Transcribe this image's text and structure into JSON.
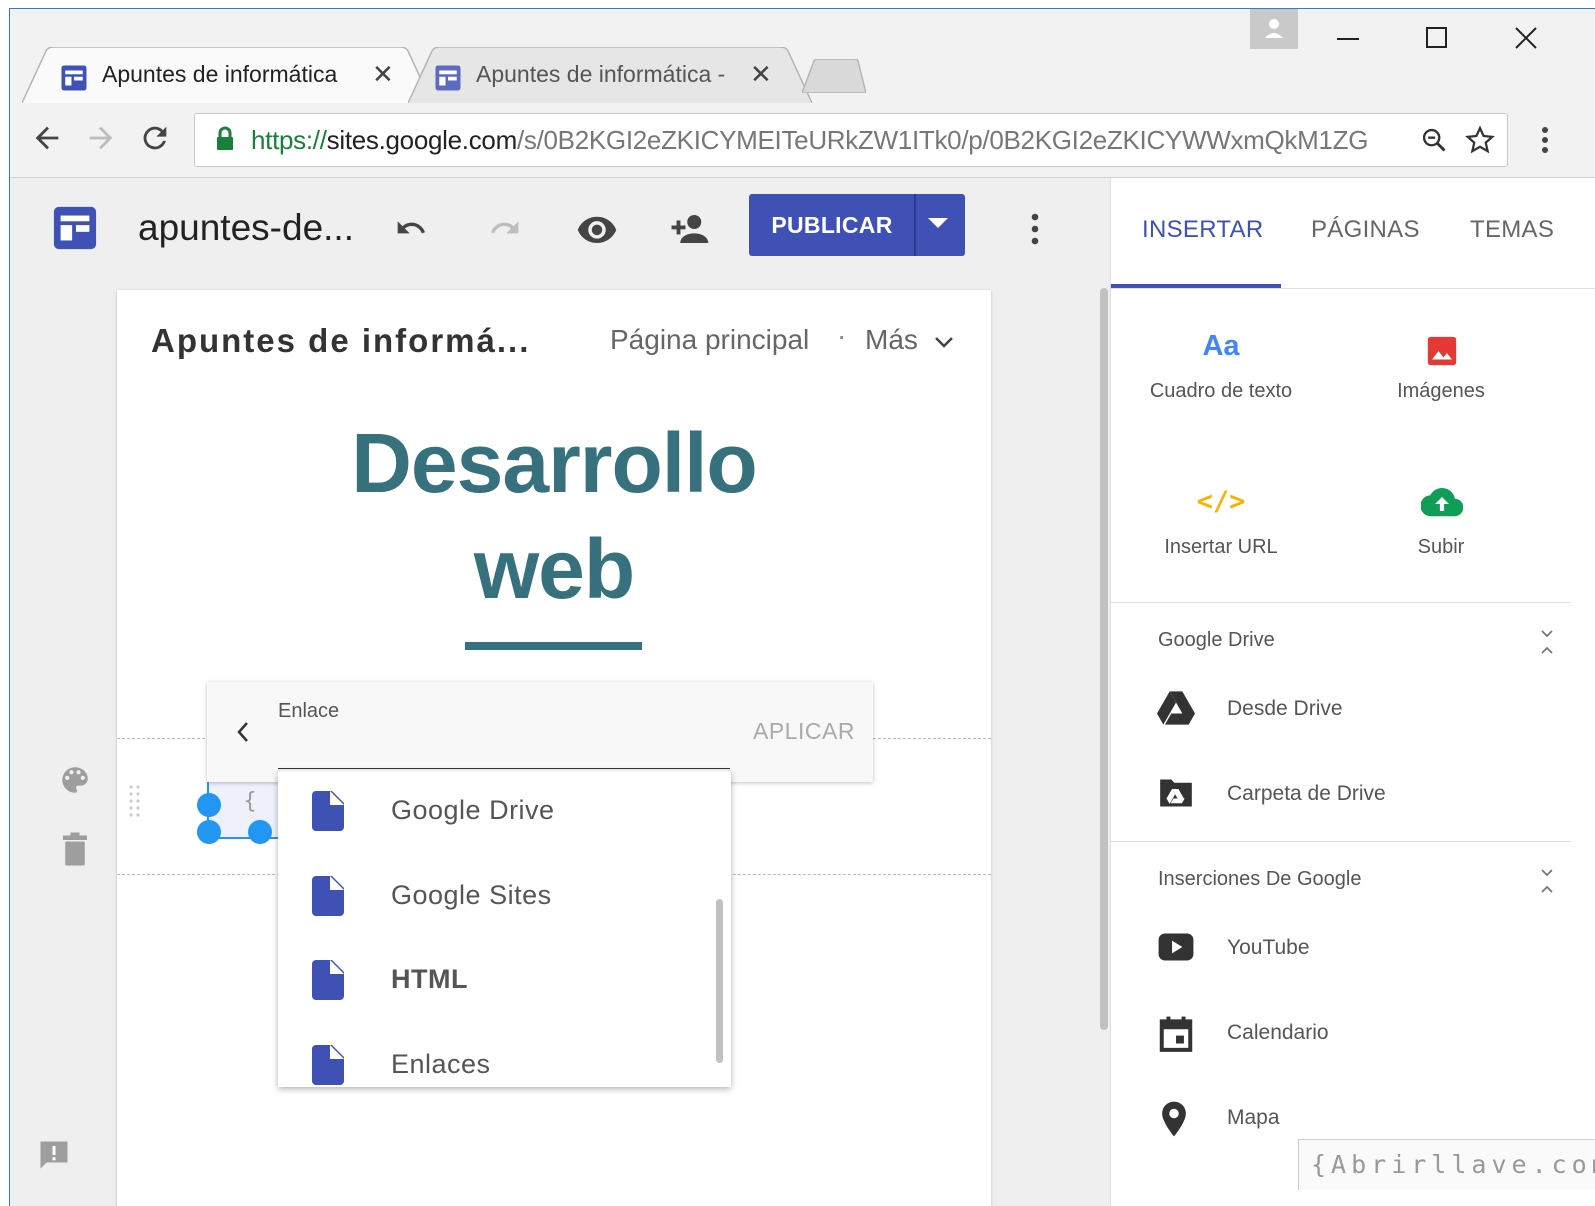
{
  "browser": {
    "tabs": [
      {
        "title": "Apuntes de informática",
        "close": "✕",
        "active": true
      },
      {
        "title": "Apuntes de informática -",
        "close": "✕",
        "active": false
      }
    ],
    "url": {
      "scheme": "https://",
      "host": "sites.google.com",
      "path": "/s/0B2KGI2eZKICYMEITeURkZW1ITk0/p/0B2KGI2eZKICYWWxmQkM1ZG"
    },
    "icons": [
      "back-icon",
      "forward-icon",
      "reload-icon",
      "lock-icon",
      "zoom-icon",
      "bookmark-star-icon",
      "menu-icon",
      "profile-icon",
      "minimize-icon",
      "maximize-icon",
      "close-icon"
    ]
  },
  "editor": {
    "site_name": "apuntes-de...",
    "publish_label": "PUBLICAR"
  },
  "page": {
    "site_title": "Apuntes de informá...",
    "nav_home": "Página principal",
    "nav_dot": "·",
    "nav_more": "Más",
    "heading_line1": "Desarrollo",
    "heading_line2": "web"
  },
  "link_editor": {
    "label": "Enlace",
    "apply": "APLICAR",
    "options": [
      "Google Drive",
      "Google Sites",
      "HTML",
      "Enlaces"
    ],
    "selected": "HTML"
  },
  "panel": {
    "tabs": [
      "INSERTAR",
      "PÁGINAS",
      "TEMAS"
    ],
    "active_tab": "INSERTAR",
    "tiles": {
      "text_box": {
        "icon": "Aa",
        "label": "Cuadro de texto"
      },
      "images": {
        "label": "Imágenes"
      },
      "embed": {
        "icon": "</>",
        "label": "Insertar URL"
      },
      "upload": {
        "label": "Subir"
      }
    },
    "drive_section": {
      "title": "Google Drive",
      "items": [
        "Desde Drive",
        "Carpeta de Drive"
      ]
    },
    "google_section": {
      "title": "Inserciones De Google",
      "items": [
        "YouTube",
        "Calendario",
        "Mapa"
      ]
    }
  },
  "watermark": "{Abrirllave.com",
  "colors": {
    "accent": "#3f51b5",
    "heading": "#37717d",
    "images_icon": "#e53935",
    "embed_icon": "#f4b400",
    "upload_icon": "#0f9d58"
  }
}
